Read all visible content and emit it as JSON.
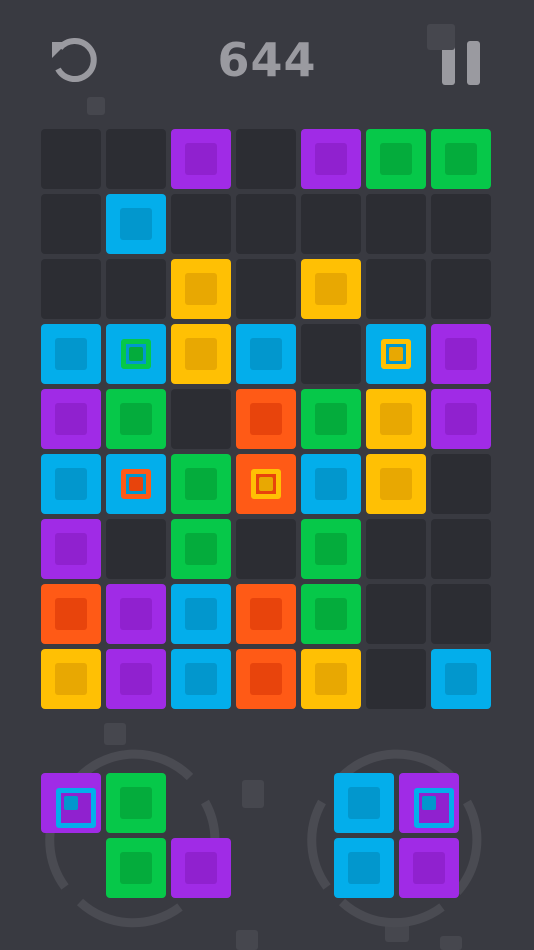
{
  "game": {
    "score": "644"
  },
  "palette": {
    "purple": {
      "outer": "#a02be6",
      "inner": "#9021cf"
    },
    "green": {
      "outer": "#06c849",
      "inner": "#04ac3c"
    },
    "blue": {
      "outer": "#03aeeb",
      "inner": "#0297cd"
    },
    "yellow": {
      "outer": "#ffc004",
      "inner": "#e8a802"
    },
    "orange": {
      "outer": "#ff5a16",
      "inner": "#e8440c"
    },
    "empty": "#2c2d33",
    "background": "#393a41",
    "control": "#9a9aa0"
  },
  "board": {
    "columns": 7,
    "rows": 9,
    "cells": [
      [
        null,
        null,
        {
          "c": "purple"
        },
        null,
        {
          "c": "purple"
        },
        {
          "c": "green"
        },
        {
          "c": "green"
        }
      ],
      [
        null,
        {
          "c": "blue"
        },
        null,
        null,
        null,
        null,
        null
      ],
      [
        null,
        null,
        {
          "c": "yellow"
        },
        null,
        {
          "c": "yellow"
        },
        null,
        null
      ],
      [
        {
          "c": "blue"
        },
        {
          "c": "blue",
          "gem": "green"
        },
        {
          "c": "yellow"
        },
        {
          "c": "blue"
        },
        null,
        {
          "c": "blue",
          "gem": "yellow"
        },
        {
          "c": "purple"
        }
      ],
      [
        {
          "c": "purple"
        },
        {
          "c": "green"
        },
        null,
        {
          "c": "orange"
        },
        {
          "c": "green"
        },
        {
          "c": "yellow"
        },
        {
          "c": "purple"
        }
      ],
      [
        {
          "c": "blue"
        },
        {
          "c": "blue",
          "gem": "orange"
        },
        {
          "c": "green"
        },
        {
          "c": "orange",
          "gem": "yellow"
        },
        {
          "c": "blue"
        },
        {
          "c": "yellow"
        },
        null
      ],
      [
        {
          "c": "purple"
        },
        null,
        {
          "c": "green"
        },
        null,
        {
          "c": "green"
        },
        null,
        null
      ],
      [
        {
          "c": "orange"
        },
        {
          "c": "purple"
        },
        {
          "c": "blue"
        },
        {
          "c": "orange"
        },
        {
          "c": "green"
        },
        null,
        null
      ],
      [
        {
          "c": "yellow"
        },
        {
          "c": "purple"
        },
        {
          "c": "blue"
        },
        {
          "c": "orange"
        },
        {
          "c": "yellow"
        },
        null,
        {
          "c": "blue"
        }
      ]
    ]
  },
  "pieces": [
    {
      "name": "piece-left",
      "cells": [
        [
          {
            "c": "purple",
            "gem": "blue"
          },
          {
            "c": "green"
          }
        ],
        [
          null,
          {
            "c": "green"
          },
          {
            "c": "purple"
          }
        ]
      ]
    },
    {
      "name": "piece-right",
      "cells": [
        [
          {
            "c": "blue"
          },
          {
            "c": "purple",
            "gem": "blue"
          }
        ],
        [
          {
            "c": "blue"
          },
          {
            "c": "purple"
          }
        ]
      ]
    }
  ]
}
